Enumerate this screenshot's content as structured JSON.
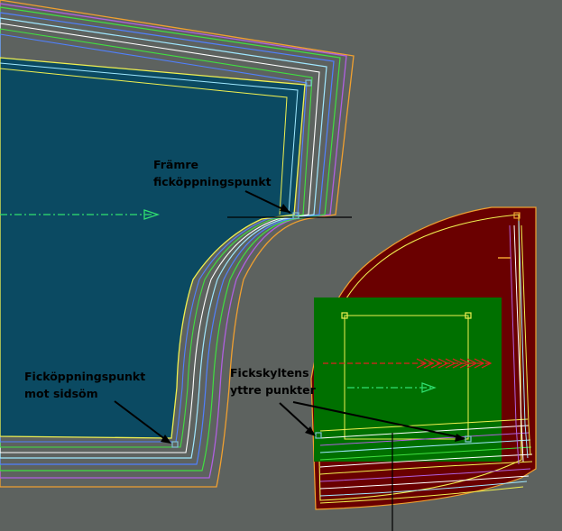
{
  "annotations": {
    "front_point": [
      "Främre",
      "ficköppningspunkt"
    ],
    "side_point": [
      "Ficköppningspunkt",
      "mot sidsöm"
    ],
    "outer_points": [
      "Fickskyltens",
      "yttre punkter"
    ]
  },
  "colors": {
    "background": "#5d625f",
    "piece_fill": "#0b4a62",
    "bag_fill": "#6a0000",
    "welt_fill": "#007000",
    "seam_allowance": "#f0a030",
    "line_yellow": "#f0f050",
    "line_green": "#40e040",
    "line_purple": "#b060e0",
    "line_blue": "#5080ff",
    "line_cyan": "#a0e8ff",
    "line_white": "#ffffff",
    "grain_line": "#30e070",
    "arrow_red": "#e02020",
    "marker": "#80c0d0"
  },
  "icons": [
    "grainline-arrow-icon",
    "point-marker-icon",
    "callout-arrow-icon"
  ]
}
